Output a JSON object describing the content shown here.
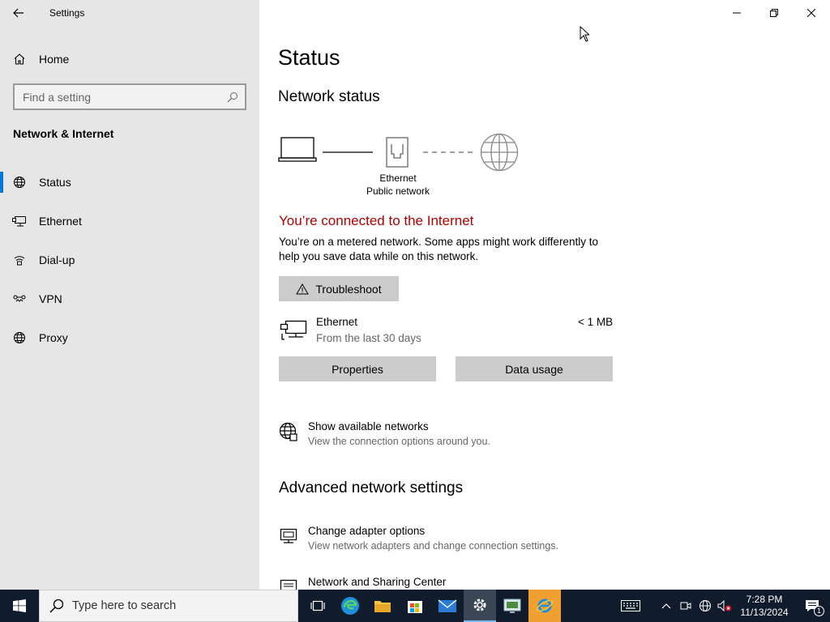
{
  "window": {
    "title": "Settings"
  },
  "sidebar": {
    "home_label": "Home",
    "search_placeholder": "Find a setting",
    "section_title": "Network & Internet",
    "items": [
      {
        "label": "Status",
        "icon": "globe-icon"
      },
      {
        "label": "Ethernet",
        "icon": "ethernet-icon"
      },
      {
        "label": "Dial-up",
        "icon": "dialup-icon"
      },
      {
        "label": "VPN",
        "icon": "vpn-icon"
      },
      {
        "label": "Proxy",
        "icon": "globe-icon"
      }
    ],
    "active_item": "Status"
  },
  "main": {
    "title": "Status",
    "network_status_heading": "Network status",
    "diagram": {
      "adapter_name": "Ethernet",
      "network_type": "Public network"
    },
    "connected_text": "You’re connected to the Internet",
    "metered_text": "You’re on a metered network. Some apps might work differently to help you save data while on this network.",
    "troubleshoot_label": "Troubleshoot",
    "ethernet": {
      "name": "Ethernet",
      "period": "From the last 30 days",
      "usage": "< 1 MB"
    },
    "properties_label": "Properties",
    "data_usage_label": "Data usage",
    "show_networks": {
      "title": "Show available networks",
      "subtitle": "View the connection options around you."
    },
    "advanced_heading": "Advanced network settings",
    "change_adapter": {
      "title": "Change adapter options",
      "subtitle": "View network adapters and change connection settings."
    },
    "sharing_center": {
      "title": "Network and Sharing Center"
    },
    "accent_color": "#0078d7",
    "connected_color": "#b20000"
  },
  "taskbar": {
    "search_placeholder": "Type here to search",
    "time": "7:28 PM",
    "date": "11/13/2024",
    "notification_count": "1"
  }
}
